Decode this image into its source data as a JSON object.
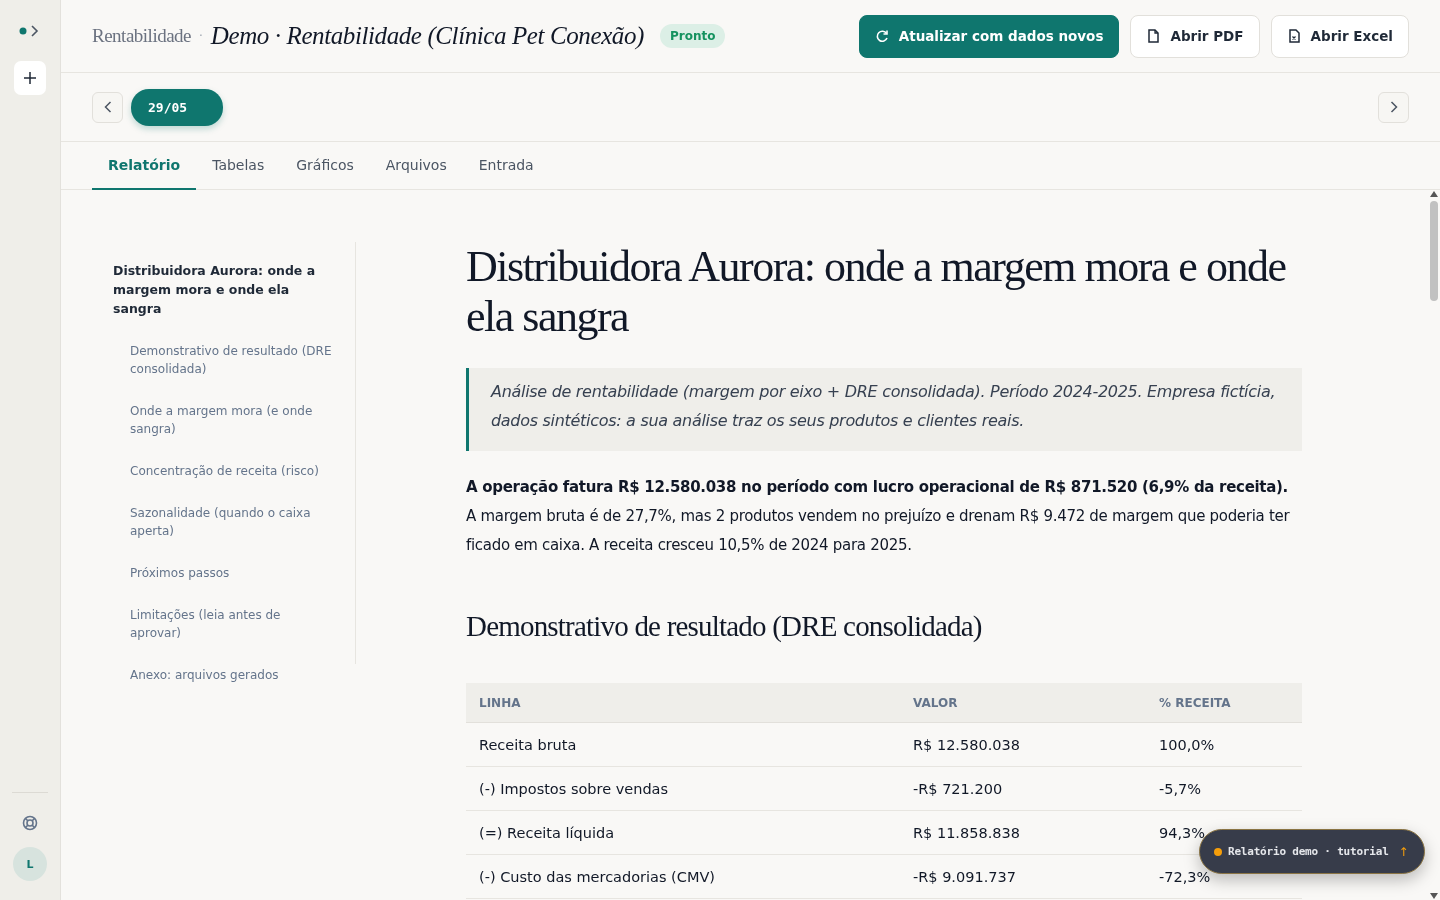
{
  "breadcrumb": {
    "section": "Rentabilidade",
    "separator": "·",
    "title": "Demo · Rentabilidade (Clínica Pet Conexão)",
    "status": "Pronto"
  },
  "actions": [
    {
      "kind": "refresh",
      "label": "Atualizar com dados novos"
    },
    {
      "kind": "pdf",
      "label": "Abrir PDF"
    },
    {
      "kind": "excel",
      "label": "Abrir Excel"
    }
  ],
  "date_chip": "29/05",
  "tabs": [
    {
      "label": "Relatório",
      "selected": true
    },
    {
      "label": "Tabelas",
      "selected": false
    },
    {
      "label": "Gráficos",
      "selected": false
    },
    {
      "label": "Arquivos",
      "selected": false
    },
    {
      "label": "Entrada",
      "selected": false
    }
  ],
  "toc": {
    "title": "Distribuidora Aurora: onde a margem mora e onde ela sangra",
    "items": [
      "Demonstrativo de resultado (DRE consolidada)",
      "Onde a margem mora (e onde sangra)",
      "Concentração de receita (risco)",
      "Sazonalidade (quando o caixa aperta)",
      "Próximos passos",
      "Limitações (leia antes de aprovar)",
      "Anexo: arquivos gerados"
    ]
  },
  "report": {
    "title": "Distribuidora Aurora: onde a margem mora e onde ela sangra",
    "quote": "Análise de rentabilidade (margem por eixo + DRE consolidada). Período 2024-2025. Empresa fictícia, dados sintéticos: a sua análise traz os seus produtos e clientes reais.",
    "summary": "**A operação fatura R$ 12.580.038 no período com lucro operacional de R$ 871.520 (6,9% da receita).** A margem bruta é de 27,7%, mas 2 produtos vendem no prejuízo e drenam R$ 9.472 de margem que poderia ter ficado em caixa. A receita cresceu 10,5% de 2024 para 2025.",
    "section_title": "Demonstrativo de resultado (DRE consolidada)",
    "table": {
      "columns": [
        "LINHA",
        "VALOR",
        "% RECEITA"
      ],
      "rows": [
        [
          "Receita bruta",
          "R$ 12.580.038",
          "100,0%"
        ],
        [
          "(-) Impostos sobre vendas",
          "-R$ 721.200",
          "-5,7%"
        ],
        [
          "(=) Receita líquida",
          "R$ 11.858.838",
          "94,3%"
        ],
        [
          "(-) Custo das mercadorias (CMV)",
          "-R$ 9.091.737",
          "-72,3%"
        ]
      ]
    }
  },
  "rail": {
    "avatar": "L"
  },
  "toast": {
    "label": "Relatório demo · tutorial",
    "arrow": "↑"
  }
}
